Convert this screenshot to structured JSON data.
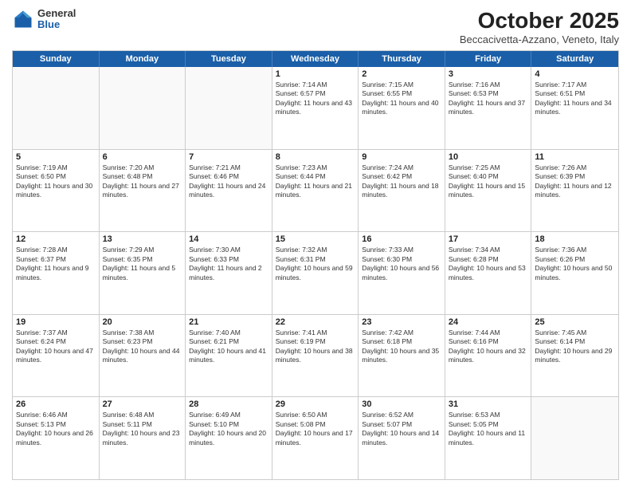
{
  "header": {
    "logo": {
      "general": "General",
      "blue": "Blue"
    },
    "title": "October 2025",
    "location": "Beccacivetta-Azzano, Veneto, Italy"
  },
  "days_of_week": [
    "Sunday",
    "Monday",
    "Tuesday",
    "Wednesday",
    "Thursday",
    "Friday",
    "Saturday"
  ],
  "weeks": [
    [
      {
        "day": "",
        "text": ""
      },
      {
        "day": "",
        "text": ""
      },
      {
        "day": "",
        "text": ""
      },
      {
        "day": "1",
        "text": "Sunrise: 7:14 AM\nSunset: 6:57 PM\nDaylight: 11 hours and 43 minutes."
      },
      {
        "day": "2",
        "text": "Sunrise: 7:15 AM\nSunset: 6:55 PM\nDaylight: 11 hours and 40 minutes."
      },
      {
        "day": "3",
        "text": "Sunrise: 7:16 AM\nSunset: 6:53 PM\nDaylight: 11 hours and 37 minutes."
      },
      {
        "day": "4",
        "text": "Sunrise: 7:17 AM\nSunset: 6:51 PM\nDaylight: 11 hours and 34 minutes."
      }
    ],
    [
      {
        "day": "5",
        "text": "Sunrise: 7:19 AM\nSunset: 6:50 PM\nDaylight: 11 hours and 30 minutes."
      },
      {
        "day": "6",
        "text": "Sunrise: 7:20 AM\nSunset: 6:48 PM\nDaylight: 11 hours and 27 minutes."
      },
      {
        "day": "7",
        "text": "Sunrise: 7:21 AM\nSunset: 6:46 PM\nDaylight: 11 hours and 24 minutes."
      },
      {
        "day": "8",
        "text": "Sunrise: 7:23 AM\nSunset: 6:44 PM\nDaylight: 11 hours and 21 minutes."
      },
      {
        "day": "9",
        "text": "Sunrise: 7:24 AM\nSunset: 6:42 PM\nDaylight: 11 hours and 18 minutes."
      },
      {
        "day": "10",
        "text": "Sunrise: 7:25 AM\nSunset: 6:40 PM\nDaylight: 11 hours and 15 minutes."
      },
      {
        "day": "11",
        "text": "Sunrise: 7:26 AM\nSunset: 6:39 PM\nDaylight: 11 hours and 12 minutes."
      }
    ],
    [
      {
        "day": "12",
        "text": "Sunrise: 7:28 AM\nSunset: 6:37 PM\nDaylight: 11 hours and 9 minutes."
      },
      {
        "day": "13",
        "text": "Sunrise: 7:29 AM\nSunset: 6:35 PM\nDaylight: 11 hours and 5 minutes."
      },
      {
        "day": "14",
        "text": "Sunrise: 7:30 AM\nSunset: 6:33 PM\nDaylight: 11 hours and 2 minutes."
      },
      {
        "day": "15",
        "text": "Sunrise: 7:32 AM\nSunset: 6:31 PM\nDaylight: 10 hours and 59 minutes."
      },
      {
        "day": "16",
        "text": "Sunrise: 7:33 AM\nSunset: 6:30 PM\nDaylight: 10 hours and 56 minutes."
      },
      {
        "day": "17",
        "text": "Sunrise: 7:34 AM\nSunset: 6:28 PM\nDaylight: 10 hours and 53 minutes."
      },
      {
        "day": "18",
        "text": "Sunrise: 7:36 AM\nSunset: 6:26 PM\nDaylight: 10 hours and 50 minutes."
      }
    ],
    [
      {
        "day": "19",
        "text": "Sunrise: 7:37 AM\nSunset: 6:24 PM\nDaylight: 10 hours and 47 minutes."
      },
      {
        "day": "20",
        "text": "Sunrise: 7:38 AM\nSunset: 6:23 PM\nDaylight: 10 hours and 44 minutes."
      },
      {
        "day": "21",
        "text": "Sunrise: 7:40 AM\nSunset: 6:21 PM\nDaylight: 10 hours and 41 minutes."
      },
      {
        "day": "22",
        "text": "Sunrise: 7:41 AM\nSunset: 6:19 PM\nDaylight: 10 hours and 38 minutes."
      },
      {
        "day": "23",
        "text": "Sunrise: 7:42 AM\nSunset: 6:18 PM\nDaylight: 10 hours and 35 minutes."
      },
      {
        "day": "24",
        "text": "Sunrise: 7:44 AM\nSunset: 6:16 PM\nDaylight: 10 hours and 32 minutes."
      },
      {
        "day": "25",
        "text": "Sunrise: 7:45 AM\nSunset: 6:14 PM\nDaylight: 10 hours and 29 minutes."
      }
    ],
    [
      {
        "day": "26",
        "text": "Sunrise: 6:46 AM\nSunset: 5:13 PM\nDaylight: 10 hours and 26 minutes."
      },
      {
        "day": "27",
        "text": "Sunrise: 6:48 AM\nSunset: 5:11 PM\nDaylight: 10 hours and 23 minutes."
      },
      {
        "day": "28",
        "text": "Sunrise: 6:49 AM\nSunset: 5:10 PM\nDaylight: 10 hours and 20 minutes."
      },
      {
        "day": "29",
        "text": "Sunrise: 6:50 AM\nSunset: 5:08 PM\nDaylight: 10 hours and 17 minutes."
      },
      {
        "day": "30",
        "text": "Sunrise: 6:52 AM\nSunset: 5:07 PM\nDaylight: 10 hours and 14 minutes."
      },
      {
        "day": "31",
        "text": "Sunrise: 6:53 AM\nSunset: 5:05 PM\nDaylight: 10 hours and 11 minutes."
      },
      {
        "day": "",
        "text": ""
      }
    ]
  ]
}
